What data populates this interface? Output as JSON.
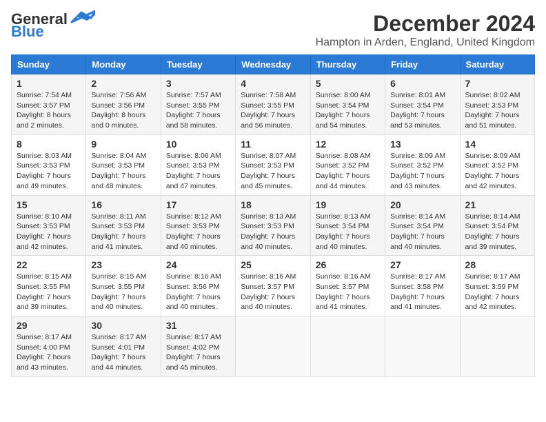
{
  "header": {
    "logo_line1": "General",
    "logo_line2": "Blue",
    "month_title": "December 2024",
    "location": "Hampton in Arden, England, United Kingdom"
  },
  "days_of_week": [
    "Sunday",
    "Monday",
    "Tuesday",
    "Wednesday",
    "Thursday",
    "Friday",
    "Saturday"
  ],
  "weeks": [
    [
      {
        "day": "1",
        "sunrise": "7:54 AM",
        "sunset": "3:57 PM",
        "daylight": "8 hours and 2 minutes."
      },
      {
        "day": "2",
        "sunrise": "7:56 AM",
        "sunset": "3:56 PM",
        "daylight": "8 hours and 0 minutes."
      },
      {
        "day": "3",
        "sunrise": "7:57 AM",
        "sunset": "3:55 PM",
        "daylight": "7 hours and 58 minutes."
      },
      {
        "day": "4",
        "sunrise": "7:58 AM",
        "sunset": "3:55 PM",
        "daylight": "7 hours and 56 minutes."
      },
      {
        "day": "5",
        "sunrise": "8:00 AM",
        "sunset": "3:54 PM",
        "daylight": "7 hours and 54 minutes."
      },
      {
        "day": "6",
        "sunrise": "8:01 AM",
        "sunset": "3:54 PM",
        "daylight": "7 hours and 53 minutes."
      },
      {
        "day": "7",
        "sunrise": "8:02 AM",
        "sunset": "3:53 PM",
        "daylight": "7 hours and 51 minutes."
      }
    ],
    [
      {
        "day": "8",
        "sunrise": "8:03 AM",
        "sunset": "3:53 PM",
        "daylight": "7 hours and 49 minutes."
      },
      {
        "day": "9",
        "sunrise": "8:04 AM",
        "sunset": "3:53 PM",
        "daylight": "7 hours and 48 minutes."
      },
      {
        "day": "10",
        "sunrise": "8:06 AM",
        "sunset": "3:53 PM",
        "daylight": "7 hours and 47 minutes."
      },
      {
        "day": "11",
        "sunrise": "8:07 AM",
        "sunset": "3:53 PM",
        "daylight": "7 hours and 45 minutes."
      },
      {
        "day": "12",
        "sunrise": "8:08 AM",
        "sunset": "3:52 PM",
        "daylight": "7 hours and 44 minutes."
      },
      {
        "day": "13",
        "sunrise": "8:09 AM",
        "sunset": "3:52 PM",
        "daylight": "7 hours and 43 minutes."
      },
      {
        "day": "14",
        "sunrise": "8:09 AM",
        "sunset": "3:52 PM",
        "daylight": "7 hours and 42 minutes."
      }
    ],
    [
      {
        "day": "15",
        "sunrise": "8:10 AM",
        "sunset": "3:53 PM",
        "daylight": "7 hours and 42 minutes."
      },
      {
        "day": "16",
        "sunrise": "8:11 AM",
        "sunset": "3:53 PM",
        "daylight": "7 hours and 41 minutes."
      },
      {
        "day": "17",
        "sunrise": "8:12 AM",
        "sunset": "3:53 PM",
        "daylight": "7 hours and 40 minutes."
      },
      {
        "day": "18",
        "sunrise": "8:13 AM",
        "sunset": "3:53 PM",
        "daylight": "7 hours and 40 minutes."
      },
      {
        "day": "19",
        "sunrise": "8:13 AM",
        "sunset": "3:54 PM",
        "daylight": "7 hours and 40 minutes."
      },
      {
        "day": "20",
        "sunrise": "8:14 AM",
        "sunset": "3:54 PM",
        "daylight": "7 hours and 40 minutes."
      },
      {
        "day": "21",
        "sunrise": "8:14 AM",
        "sunset": "3:54 PM",
        "daylight": "7 hours and 39 minutes."
      }
    ],
    [
      {
        "day": "22",
        "sunrise": "8:15 AM",
        "sunset": "3:55 PM",
        "daylight": "7 hours and 39 minutes."
      },
      {
        "day": "23",
        "sunrise": "8:15 AM",
        "sunset": "3:55 PM",
        "daylight": "7 hours and 40 minutes."
      },
      {
        "day": "24",
        "sunrise": "8:16 AM",
        "sunset": "3:56 PM",
        "daylight": "7 hours and 40 minutes."
      },
      {
        "day": "25",
        "sunrise": "8:16 AM",
        "sunset": "3:57 PM",
        "daylight": "7 hours and 40 minutes."
      },
      {
        "day": "26",
        "sunrise": "8:16 AM",
        "sunset": "3:57 PM",
        "daylight": "7 hours and 41 minutes."
      },
      {
        "day": "27",
        "sunrise": "8:17 AM",
        "sunset": "3:58 PM",
        "daylight": "7 hours and 41 minutes."
      },
      {
        "day": "28",
        "sunrise": "8:17 AM",
        "sunset": "3:59 PM",
        "daylight": "7 hours and 42 minutes."
      }
    ],
    [
      {
        "day": "29",
        "sunrise": "8:17 AM",
        "sunset": "4:00 PM",
        "daylight": "7 hours and 43 minutes."
      },
      {
        "day": "30",
        "sunrise": "8:17 AM",
        "sunset": "4:01 PM",
        "daylight": "7 hours and 44 minutes."
      },
      {
        "day": "31",
        "sunrise": "8:17 AM",
        "sunset": "4:02 PM",
        "daylight": "7 hours and 45 minutes."
      },
      null,
      null,
      null,
      null
    ]
  ]
}
